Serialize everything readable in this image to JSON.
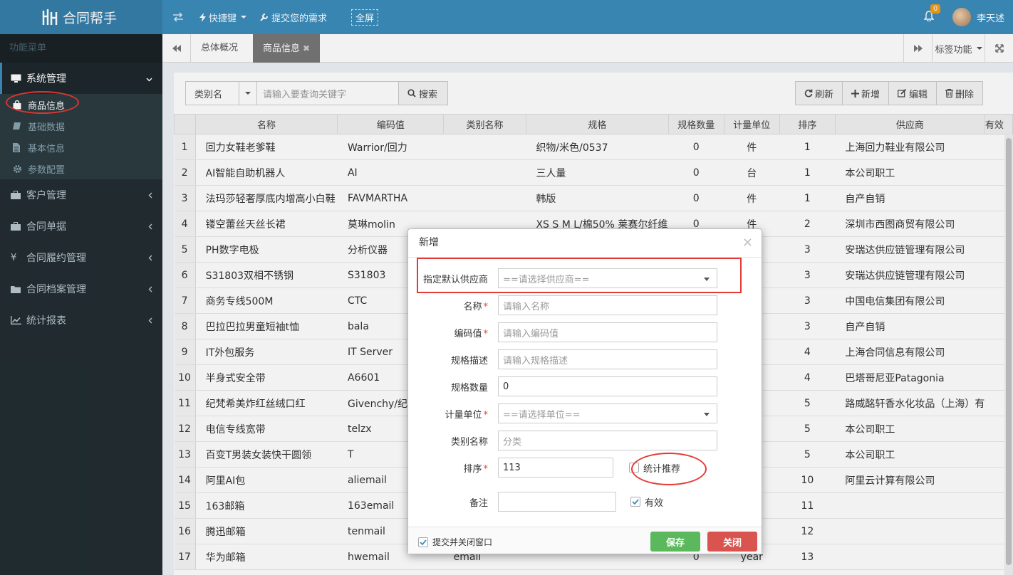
{
  "app": {
    "title": "合同帮手"
  },
  "topnav": {
    "shortcut": "快捷键",
    "request": "提交您的需求",
    "fullscreen": "全屏"
  },
  "user": {
    "name": "李天述",
    "notifications": "0"
  },
  "sidebar": {
    "header": "功能菜单",
    "groups": [
      {
        "label": "系统管理",
        "icon": "monitor-icon"
      },
      {
        "label": "客户管理",
        "icon": "briefcase-icon"
      },
      {
        "label": "合同单据",
        "icon": "briefcase-icon"
      },
      {
        "label": "合同履约管理",
        "icon": "yen-icon"
      },
      {
        "label": "合同档案管理",
        "icon": "folder-icon"
      },
      {
        "label": "统计报表",
        "icon": "line-chart-icon"
      }
    ],
    "subitems": [
      {
        "label": "商品信息",
        "icon": "shopping-bag-icon"
      },
      {
        "label": "基础数据",
        "icon": "book-icon"
      },
      {
        "label": "基本信息",
        "icon": "file-icon"
      },
      {
        "label": "参数配置",
        "icon": "gear-icon"
      }
    ]
  },
  "tabs": {
    "overview": "总体概况",
    "product": "商品信息",
    "func": "标签功能"
  },
  "toolbar": {
    "category": "类别名",
    "search_placeholder": "请输入要查询关键字",
    "search": "搜索",
    "refresh": "刷新",
    "add": "新增",
    "edit": "编辑",
    "delete": "删除"
  },
  "table": {
    "headers": [
      "名称",
      "编码值",
      "类别名称",
      "规格",
      "规格数量",
      "计量单位",
      "排序",
      "供应商",
      "有效"
    ],
    "rows": [
      [
        "1",
        "回力女鞋老爹鞋",
        "Warrior/回力",
        "",
        "织物/米色/0537",
        "0",
        "件",
        "1",
        "上海回力鞋业有限公司"
      ],
      [
        "2",
        "AI智能自助机器人",
        "AI",
        "",
        "三人量",
        "0",
        "台",
        "1",
        "本公司职工"
      ],
      [
        "3",
        "法玛莎轻奢厚底内增高小白鞋",
        "FAVMARTHA",
        "",
        "韩版",
        "0",
        "件",
        "1",
        "自产自销"
      ],
      [
        "4",
        "镂空蕾丝天丝长裙",
        "莫琳molin",
        "",
        "XS S M L/棉50% 莱赛尔纤维",
        "0",
        "件",
        "2",
        "深圳市西图商贸有限公司"
      ],
      [
        "5",
        "PH数字电极",
        "分析仪器",
        "",
        "",
        "",
        "",
        "3",
        "安瑞达供应链管理有限公司"
      ],
      [
        "6",
        "S31803双相不锈钢",
        "S31803",
        "",
        "",
        "",
        "",
        "3",
        "安瑞达供应链管理有限公司"
      ],
      [
        "7",
        "商务专线500M",
        "CTC",
        "",
        "",
        "",
        "",
        "3",
        "中国电信集团有限公司"
      ],
      [
        "8",
        "巴拉巴拉男童短袖t恤",
        "bala",
        "",
        "",
        "",
        "",
        "3",
        "自产自销"
      ],
      [
        "9",
        "IT外包服务",
        "IT Server",
        "",
        "",
        "",
        "",
        "4",
        "上海合同信息有限公司"
      ],
      [
        "10",
        "半身式安全带",
        "A6601",
        "",
        "",
        "",
        "",
        "4",
        "巴塔哥尼亚Patagonia"
      ],
      [
        "11",
        "纪梵希美炸红丝绒口红",
        "Givenchy/纪梵",
        "",
        "",
        "",
        "",
        "5",
        "路威酩轩香水化妆品（上海）有"
      ],
      [
        "12",
        "电信专线宽带",
        "telzx",
        "",
        "",
        "",
        "",
        "5",
        "本公司职工"
      ],
      [
        "13",
        "百变T男装女装快干圆领",
        "T",
        "",
        "",
        "",
        "",
        "5",
        "本公司职工"
      ],
      [
        "14",
        "阿里AI包",
        "aliemail",
        "",
        "",
        "",
        "",
        "10",
        "阿里云计算有限公司"
      ],
      [
        "15",
        "163邮箱",
        "163email",
        "",
        "",
        "",
        "",
        "11",
        ""
      ],
      [
        "16",
        "腾迅邮箱",
        "tenmail",
        "",
        "",
        "",
        "",
        "12",
        ""
      ],
      [
        "17",
        "华为邮箱",
        "hwemail",
        "email",
        "",
        "0",
        "year",
        "13",
        ""
      ]
    ]
  },
  "modal": {
    "title": "新增",
    "supplier_label": "指定默认供应商",
    "supplier_placeholder": "==请选择供应商==",
    "name_label": "名称",
    "name_placeholder": "请输入名称",
    "code_label": "编码值",
    "code_placeholder": "请输入编码值",
    "spec_label": "规格描述",
    "spec_placeholder": "请输入规格描述",
    "qty_label": "规格数量",
    "qty_value": "0",
    "unit_label": "计量单位",
    "unit_placeholder": "==请选择单位==",
    "category_label": "类别名称",
    "category_placeholder": "分类",
    "sort_label": "排序",
    "sort_value": "113",
    "recommend_label": "统计推荐",
    "remark_label": "备注",
    "valid_label": "有效",
    "close_after_submit": "提交并关闭窗口",
    "save": "保存",
    "close": "关闭"
  },
  "colors": {
    "primary": "#3c8dbc",
    "sidebar": "#222d32",
    "save": "#5cb85c",
    "close": "#d9534f",
    "highlight": "#e53935"
  }
}
